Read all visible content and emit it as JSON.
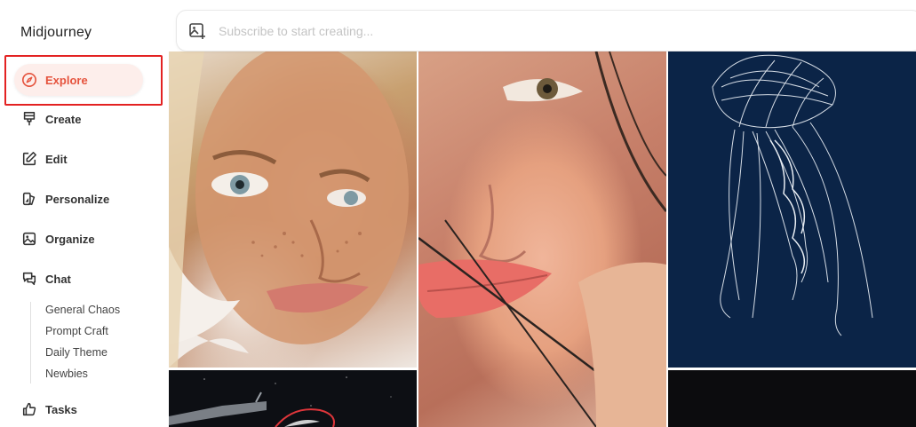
{
  "app": {
    "name": "Midjourney"
  },
  "nav": {
    "items": [
      {
        "id": "explore",
        "label": "Explore",
        "icon": "compass-icon",
        "active": true
      },
      {
        "id": "create",
        "label": "Create",
        "icon": "brush-icon"
      },
      {
        "id": "edit",
        "label": "Edit",
        "icon": "edit-icon"
      },
      {
        "id": "personalize",
        "label": "Personalize",
        "icon": "personalize-icon"
      },
      {
        "id": "organize",
        "label": "Organize",
        "icon": "image-icon"
      },
      {
        "id": "chat",
        "label": "Chat",
        "icon": "chat-icon"
      }
    ],
    "chat_rooms": [
      "General Chaos",
      "Prompt Craft",
      "Daily Theme",
      "Newbies"
    ],
    "tasks": {
      "label": "Tasks",
      "icon": "thumbs-up-icon"
    }
  },
  "search": {
    "placeholder": "Subscribe to start creating..."
  },
  "gallery": {
    "tiles": [
      {
        "id": "freckled-woman-portrait"
      },
      {
        "id": "smiling-woman-closeup"
      },
      {
        "id": "wireframe-jellyfish"
      },
      {
        "id": "space-station-dark"
      },
      {
        "id": "dark-image"
      }
    ]
  },
  "colors": {
    "accent": "#e5533d",
    "highlight": "#e32222"
  }
}
